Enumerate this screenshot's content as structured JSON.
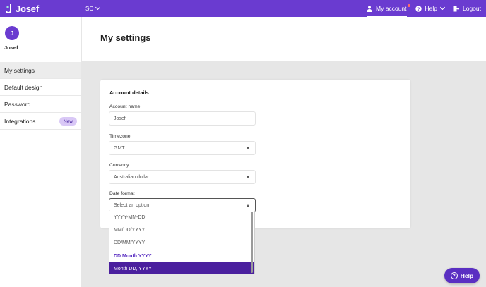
{
  "app": {
    "logo_text": "Josef"
  },
  "topbar": {
    "workspace": "SC",
    "my_account": "My account",
    "help": "Help",
    "logout": "Logout"
  },
  "sidebar": {
    "avatar_initial": "J",
    "user_name": "Josef",
    "items": [
      {
        "label": "My settings",
        "active": true
      },
      {
        "label": "Default design"
      },
      {
        "label": "Password"
      },
      {
        "label": "Integrations",
        "badge": "New"
      }
    ]
  },
  "page": {
    "title": "My settings"
  },
  "card": {
    "title": "Account details",
    "account_name_label": "Account name",
    "account_name_value": "Josef",
    "timezone_label": "Timezone",
    "timezone_value": "GMT",
    "currency_label": "Currency",
    "currency_value": "Australian dollar",
    "date_format_label": "Date format",
    "date_format_placeholder": "Select an option"
  },
  "date_format_options": [
    "YYYY-MM-DD",
    "MM/DD/YYYY",
    "DD/MM/YYYY",
    "DD Month YYYY",
    "Month DD, YYYY"
  ],
  "help_fab": {
    "label": "Help"
  },
  "colors": {
    "brand": "#6a3bd0",
    "hover": "#4a1f9e",
    "badge_bg": "#d9c8f6"
  }
}
